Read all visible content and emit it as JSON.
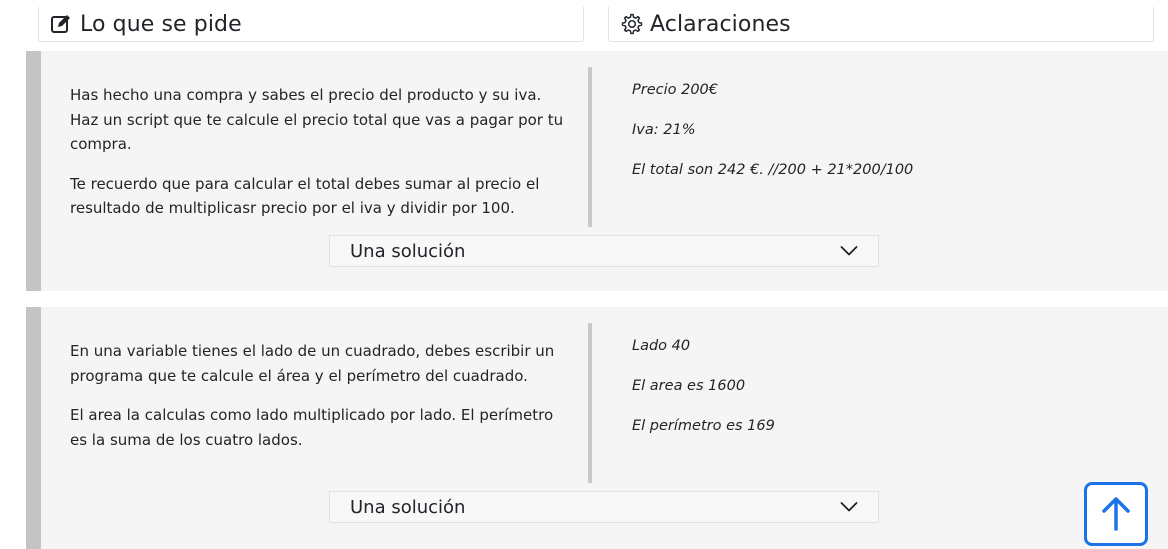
{
  "headers": {
    "left": {
      "title": "Lo que se pide",
      "icon": "edit-icon"
    },
    "right": {
      "title": "Aclaraciones",
      "icon": "gear-icon"
    }
  },
  "exercises": [
    {
      "statement": [
        "Has hecho una compra y sabes el precio del producto y su iva. Haz un script que te calcule el precio total que vas a pagar por tu compra.",
        "Te recuerdo que para calcular el total debes sumar al precio el resultado de multiplicasr precio por el iva y dividir por 100."
      ],
      "clarifications": [
        "Precio 200€",
        "Iva: 21%",
        "El total son 242 €.  //200 + 21*200/100"
      ],
      "solution_label": "Una solución"
    },
    {
      "statement": [
        "En una variable tienes el lado de un cuadrado, debes escribir un programa que te calcule el área y el perímetro del cuadrado.",
        "El area la calculas como lado multiplicado por lado. El perímetro es la suma de los cuatro lados."
      ],
      "clarifications": [
        "Lado 40",
        "El area es 1600",
        "El perímetro es 169"
      ],
      "solution_label": "Una solución"
    }
  ],
  "colors": {
    "accent": "#1a73e8",
    "card_bg": "#f5f5f5",
    "card_border": "#c4c4c4"
  },
  "scroll_top_icon": "arrow-up-icon"
}
